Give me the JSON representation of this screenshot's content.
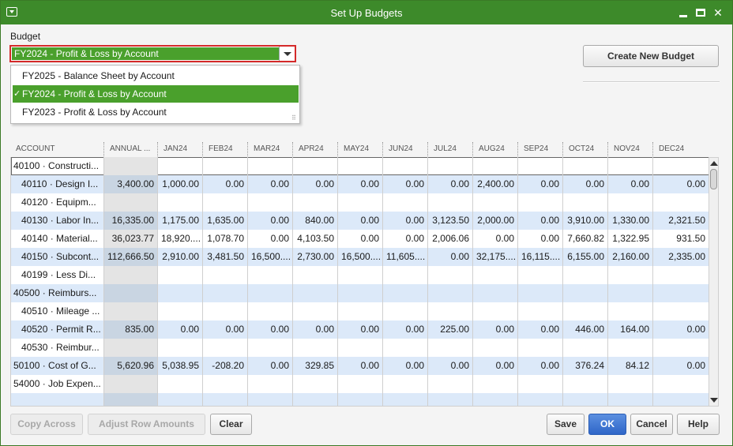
{
  "window": {
    "title": "Set Up Budgets"
  },
  "budget": {
    "label": "Budget",
    "selected": "FY2024 - Profit & Loss by Account",
    "options": [
      {
        "label": "FY2025 - Balance Sheet by Account",
        "selected": false
      },
      {
        "label": "FY2024 - Profit & Loss by Account",
        "selected": true,
        "check": "✓"
      },
      {
        "label": "FY2023 - Profit & Loss by Account",
        "selected": false
      }
    ]
  },
  "buttons": {
    "create_new_budget": "Create New Budget",
    "copy_across": "Copy Across",
    "adjust_row_amounts": "Adjust Row Amounts",
    "clear": "Clear",
    "save": "Save",
    "ok": "OK",
    "cancel": "Cancel",
    "help": "Help"
  },
  "grid": {
    "columns": [
      "ACCOUNT",
      "ANNUAL ...",
      "JAN24",
      "FEB24",
      "MAR24",
      "APR24",
      "MAY24",
      "JUN24",
      "JUL24",
      "AUG24",
      "SEP24",
      "OCT24",
      "NOV24",
      "DEC24"
    ],
    "rows": [
      {
        "account": "40100 · Constructi...",
        "values": [
          "",
          "",
          "",
          "",
          "",
          "",
          "",
          "",
          "",
          "",
          "",
          "",
          ""
        ]
      },
      {
        "account": "40110 · Design I...",
        "values": [
          "3,400.00",
          "1,000.00",
          "0.00",
          "0.00",
          "0.00",
          "0.00",
          "0.00",
          "0.00",
          "2,400.00",
          "0.00",
          "0.00",
          "0.00",
          "0.00"
        ]
      },
      {
        "account": "40120 · Equipm...",
        "values": [
          "",
          "",
          "",
          "",
          "",
          "",
          "",
          "",
          "",
          "",
          "",
          "",
          ""
        ]
      },
      {
        "account": "40130 · Labor In...",
        "values": [
          "16,335.00",
          "1,175.00",
          "1,635.00",
          "0.00",
          "840.00",
          "0.00",
          "0.00",
          "3,123.50",
          "2,000.00",
          "0.00",
          "3,910.00",
          "1,330.00",
          "2,321.50"
        ]
      },
      {
        "account": "40140 · Material...",
        "values": [
          "36,023.77",
          "18,920....",
          "1,078.70",
          "0.00",
          "4,103.50",
          "0.00",
          "0.00",
          "2,006.06",
          "0.00",
          "0.00",
          "7,660.82",
          "1,322.95",
          "931.50"
        ]
      },
      {
        "account": "40150 · Subcont...",
        "values": [
          "112,666.50",
          "2,910.00",
          "3,481.50",
          "16,500....",
          "2,730.00",
          "16,500....",
          "11,605....",
          "0.00",
          "32,175....",
          "16,115....",
          "6,155.00",
          "2,160.00",
          "2,335.00"
        ]
      },
      {
        "account": "40199 · Less Di...",
        "values": [
          "",
          "",
          "",
          "",
          "",
          "",
          "",
          "",
          "",
          "",
          "",
          "",
          ""
        ]
      },
      {
        "account": "40500 · Reimburs...",
        "values": [
          "",
          "",
          "",
          "",
          "",
          "",
          "",
          "",
          "",
          "",
          "",
          "",
          ""
        ]
      },
      {
        "account": "40510 · Mileage ...",
        "values": [
          "",
          "",
          "",
          "",
          "",
          "",
          "",
          "",
          "",
          "",
          "",
          "",
          ""
        ]
      },
      {
        "account": "40520 · Permit R...",
        "values": [
          "835.00",
          "0.00",
          "0.00",
          "0.00",
          "0.00",
          "0.00",
          "0.00",
          "225.00",
          "0.00",
          "0.00",
          "446.00",
          "164.00",
          "0.00"
        ]
      },
      {
        "account": "40530 · Reimbur...",
        "values": [
          "",
          "",
          "",
          "",
          "",
          "",
          "",
          "",
          "",
          "",
          "",
          "",
          ""
        ]
      },
      {
        "account": "50100 · Cost of G...",
        "values": [
          "5,620.96",
          "5,038.95",
          "-208.20",
          "0.00",
          "329.85",
          "0.00",
          "0.00",
          "0.00",
          "0.00",
          "0.00",
          "376.24",
          "84.12",
          "0.00"
        ]
      },
      {
        "account": "54000 · Job Expen...",
        "values": [
          "",
          "",
          "",
          "",
          "",
          "",
          "",
          "",
          "",
          "",
          "",
          "",
          ""
        ]
      },
      {
        "account": "",
        "values": [
          "",
          "",
          "",
          "",
          "",
          "",
          "",
          "",
          "",
          "",
          "",
          "",
          ""
        ]
      }
    ]
  }
}
